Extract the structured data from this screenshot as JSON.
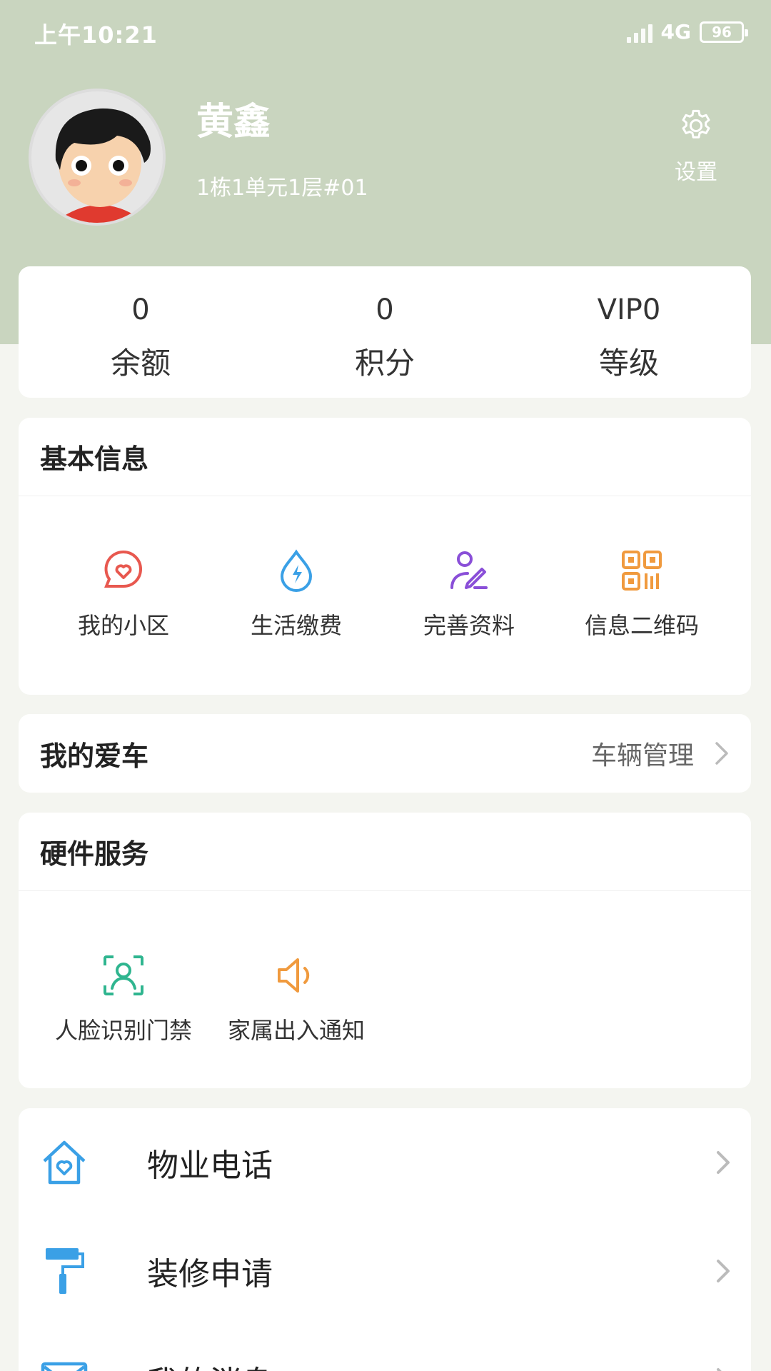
{
  "status": {
    "time": "上午10:21",
    "network": "4G",
    "battery": "96"
  },
  "profile": {
    "name": "黄鑫",
    "address": "1栋1单元1层#01",
    "settings_label": "设置"
  },
  "stats": [
    {
      "value": "0",
      "label": "余额"
    },
    {
      "value": "0",
      "label": "积分"
    },
    {
      "value": "VIP0",
      "label": "等级"
    }
  ],
  "basic_info": {
    "title": "基本信息",
    "items": [
      {
        "label": "我的小区",
        "icon": "community-heart-icon",
        "color": "#e8584f"
      },
      {
        "label": "生活缴费",
        "icon": "water-bolt-icon",
        "color": "#3aa0e6"
      },
      {
        "label": "完善资料",
        "icon": "user-edit-icon",
        "color": "#8a4fd8"
      },
      {
        "label": "信息二维码",
        "icon": "qr-code-icon",
        "color": "#f09a3e"
      }
    ]
  },
  "car": {
    "title": "我的爱车",
    "link_label": "车辆管理"
  },
  "hardware": {
    "title": "硬件服务",
    "items": [
      {
        "label": "人脸识别门禁",
        "icon": "face-scan-icon",
        "color": "#2fb58f"
      },
      {
        "label": "家属出入通知",
        "icon": "speaker-icon",
        "color": "#f09a3e"
      }
    ]
  },
  "menu": [
    {
      "label": "物业电话",
      "icon": "house-heart-icon",
      "color": "#3aa0e6"
    },
    {
      "label": "装修申请",
      "icon": "paint-roller-icon",
      "color": "#3aa0e6"
    },
    {
      "label": "我的消息",
      "icon": "mail-icon",
      "color": "#3aa0e6"
    }
  ]
}
